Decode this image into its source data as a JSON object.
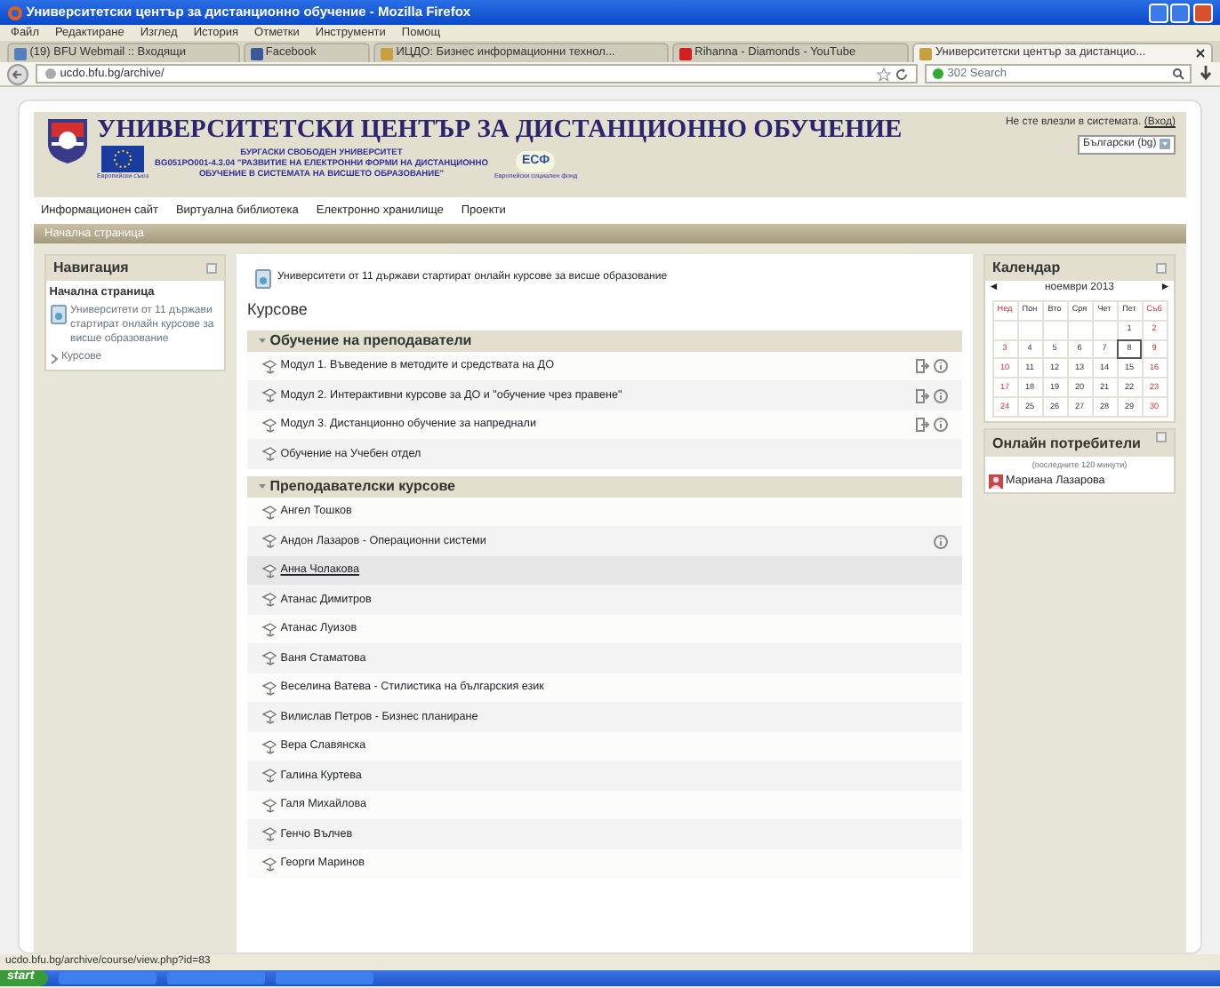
{
  "window": {
    "title": "Университетски център за дистанционно обучение - Mozilla Firefox"
  },
  "menu": [
    "Файл",
    "Редактиране",
    "Изглед",
    "История",
    "Отметки",
    "Инструменти",
    "Помощ"
  ],
  "tabs": [
    {
      "label": "(19) BFU Webmail :: Входящи",
      "selected": false
    },
    {
      "label": "Facebook",
      "selected": false
    },
    {
      "label": "ИЦДО: Бизнес информационни технол...",
      "selected": false
    },
    {
      "label": "Rihanna - Diamonds - YouTube",
      "selected": false
    },
    {
      "label": "Университетски център за дистанцио...",
      "selected": true
    }
  ],
  "address": "ucdo.bfu.bg/archive/",
  "search": {
    "placeholder": "302 Search"
  },
  "site": {
    "title": "УНИВЕРСИТЕТСКИ ЦЕНТЪР ЗА ДИСТАНЦИОННО ОБУЧЕНИЕ",
    "project_lines": [
      "БУРГАСКИ СВОБОДЕН УНИВЕРСИТЕТ",
      "BG051PO001-4.3.04 \"РАЗВИТИЕ НА ЕЛЕКТРОННИ ФОРМИ НА ДИСТАНЦИОННО",
      "ОБУЧЕНИЕ В СИСТЕМАТА НА ВИСШЕТО ОБРАЗОВАНИЕ\""
    ],
    "eu_caption": "Европейски съюз",
    "esf_label": "ЕСФ",
    "esf_caption": "Европейски социален фонд",
    "login_text": "Не сте влезли в системата.",
    "login_link": "(Вход)",
    "language": "Български (bg)",
    "nav": [
      "Информационен сайт",
      "Виртуална библиотека",
      "Електронно хранилище",
      "Проекти"
    ],
    "breadcrumb": "Начална страница"
  },
  "navigation": {
    "title": "Навигация",
    "home": "Начална страница",
    "news": "Университети от 11 държави стартират онлайн курсове за висше образование",
    "courses": "Курсове"
  },
  "main": {
    "news": "Университети от 11 държави стартират онлайн курсове за висше образование",
    "heading": "Курсове",
    "categories": [
      {
        "name": "Обучение на преподаватели",
        "expanded": true,
        "courses": [
          {
            "name": "Модул 1. Въведение в методите и средствата на ДО",
            "enrol": true,
            "info": true,
            "hovered": false
          },
          {
            "name": "Модул 2. Интерактивни курсове за ДО и \"обучение чрез правене\"",
            "enrol": true,
            "info": true,
            "hovered": false
          },
          {
            "name": "Модул 3. Дистанционно обучение за напреднали",
            "enrol": true,
            "info": true,
            "hovered": false
          },
          {
            "name": "Обучение на Учебен отдел",
            "enrol": false,
            "info": false,
            "hovered": false
          }
        ]
      },
      {
        "name": "Преподавателски курсове",
        "expanded": true,
        "courses": [
          {
            "name": "Ангел Тошков",
            "enrol": false,
            "info": false,
            "hovered": false
          },
          {
            "name": "Андон Лазаров - Операционни системи",
            "enrol": false,
            "info": true,
            "hovered": false
          },
          {
            "name": "Анна Чолакова",
            "enrol": false,
            "info": false,
            "hovered": true
          },
          {
            "name": "Атанас Димитров",
            "enrol": false,
            "info": false,
            "hovered": false
          },
          {
            "name": "Атанас Луизов",
            "enrol": false,
            "info": false,
            "hovered": false
          },
          {
            "name": "Ваня Стаматова",
            "enrol": false,
            "info": false,
            "hovered": false
          },
          {
            "name": "Веселина Ватева - Стилистика на българския език",
            "enrol": false,
            "info": false,
            "hovered": false
          },
          {
            "name": "Вилислав Петров - Бизнес планиране",
            "enrol": false,
            "info": false,
            "hovered": false
          },
          {
            "name": "Вера Славянска",
            "enrol": false,
            "info": false,
            "hovered": false
          },
          {
            "name": "Галина Куртева",
            "enrol": false,
            "info": false,
            "hovered": false
          },
          {
            "name": "Галя Михайлова",
            "enrol": false,
            "info": false,
            "hovered": false
          },
          {
            "name": "Генчо Вълчев",
            "enrol": false,
            "info": false,
            "hovered": false
          },
          {
            "name": "Георги Маринов",
            "enrol": false,
            "info": false,
            "hovered": false
          }
        ]
      }
    ]
  },
  "calendar": {
    "title": "Календар",
    "prev": "◄",
    "month": "ноември 2013",
    "next": "►",
    "weekdays": [
      "Нед",
      "Пон",
      "Вто",
      "Сря",
      "Чет",
      "Пет",
      "Съб"
    ],
    "weeks": [
      [
        {
          "d": "1",
          "today": false
        },
        {
          "d": "2",
          "today": false
        }
      ],
      [
        {
          "d": "3",
          "today": false
        },
        {
          "d": "4",
          "today": false
        },
        {
          "d": "5",
          "today": false
        },
        {
          "d": "6",
          "today": false
        },
        {
          "d": "7",
          "today": false
        },
        {
          "d": "8",
          "today": true
        },
        {
          "d": "9",
          "today": false
        }
      ],
      [
        {
          "d": "10",
          "today": false
        },
        {
          "d": "11",
          "today": false
        },
        {
          "d": "12",
          "today": false
        },
        {
          "d": "13",
          "today": false
        },
        {
          "d": "14",
          "today": false
        },
        {
          "d": "15",
          "today": false
        },
        {
          "d": "16",
          "today": false
        }
      ],
      [
        {
          "d": "17",
          "today": false
        },
        {
          "d": "18",
          "today": false
        },
        {
          "d": "19",
          "today": false
        },
        {
          "d": "20",
          "today": false
        },
        {
          "d": "21",
          "today": false
        },
        {
          "d": "22",
          "today": false
        },
        {
          "d": "23",
          "today": false
        }
      ],
      [
        {
          "d": "24",
          "today": false
        },
        {
          "d": "25",
          "today": false
        },
        {
          "d": "26",
          "today": false
        },
        {
          "d": "27",
          "today": false
        },
        {
          "d": "28",
          "today": false
        },
        {
          "d": "29",
          "today": false
        },
        {
          "d": "30",
          "today": false
        }
      ]
    ]
  },
  "online": {
    "title": "Онлайн потребители",
    "note": "(последните 120 минути)",
    "users": [
      "Мариана Лазарова"
    ]
  },
  "status_bar": "ucdo.bfu.bg/archive/course/view.php?id=83",
  "taskbar": {
    "start": "start"
  }
}
